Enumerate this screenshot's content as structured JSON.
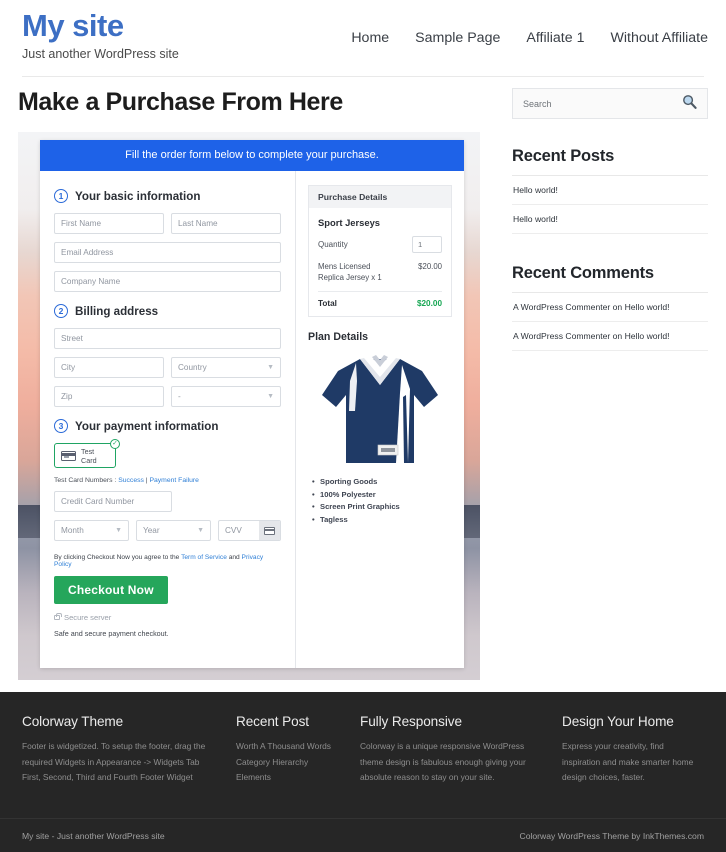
{
  "header": {
    "site_title": "My site",
    "tagline": "Just another WordPress site",
    "nav": [
      {
        "label": "Home"
      },
      {
        "label": "Sample Page"
      },
      {
        "label": "Affiliate 1"
      },
      {
        "label": "Without Affiliate"
      }
    ]
  },
  "main": {
    "page_title": "Make a Purchase From Here",
    "banner": "Fill the order form below to complete your purchase.",
    "steps": [
      {
        "num": "1",
        "title": "Your basic information"
      },
      {
        "num": "2",
        "title": "Billing address"
      },
      {
        "num": "3",
        "title": "Your payment information"
      }
    ],
    "fields": {
      "first_name": "First Name",
      "last_name": "Last Name",
      "email": "Email Address",
      "company": "Company Name",
      "street": "Street",
      "city": "City",
      "country": "Country",
      "zip": "Zip",
      "state": "-",
      "credit_card": "Credit Card Number",
      "month": "Month",
      "year": "Year",
      "cvv": "CVV"
    },
    "payment": {
      "chip_label": "Test Card",
      "check_glyph": "✓",
      "test_numbers_prefix": "Test Card Numbers : ",
      "success_link": "Success",
      "separator": " | ",
      "failure_link": "Payment Failure"
    },
    "terms": {
      "prefix": "By clicking Checkout Now you agree to the ",
      "tos": "Term of Service",
      "mid": " and ",
      "privacy": "Privacy Policy"
    },
    "checkout_button": "Checkout Now",
    "secure_server": "Secure server",
    "safe_note": "Safe and secure payment checkout."
  },
  "purchase_details": {
    "heading": "Purchase Details",
    "product": "Sport Jerseys",
    "quantity_label": "Quantity",
    "quantity_value": "1",
    "line_item_desc": "Mens Licensed Replica Jersey x 1",
    "line_item_price": "$20.00",
    "total_label": "Total",
    "total_value": "$20.00",
    "total_color": "#18a754"
  },
  "plan_details": {
    "title": "Plan Details",
    "features": [
      "Sporting Goods",
      "100% Polyester",
      "Screen Print Graphics",
      "Tagless"
    ]
  },
  "sidebar": {
    "search_placeholder": "Search",
    "recent_posts_title": "Recent Posts",
    "recent_posts": [
      "Hello world!",
      "Hello world!"
    ],
    "recent_comments_title": "Recent Comments",
    "recent_comments": [
      "A WordPress Commenter on Hello world!",
      "A WordPress Commenter on Hello world!"
    ]
  },
  "footer": {
    "columns": [
      {
        "title": "Colorway Theme",
        "text": "Footer is widgetized. To setup the footer, drag the required Widgets in Appearance -> Widgets Tab First, Second, Third and Fourth Footer Widget"
      },
      {
        "title": "Recent Post",
        "items": [
          "Worth A Thousand Words",
          "Category Hierarchy",
          "Elements"
        ]
      },
      {
        "title": "Fully Responsive",
        "text": "Colorway is a unique responsive WordPress theme design is fabulous enough giving your absolute reason to stay on your site."
      },
      {
        "title": "Design Your Home",
        "text": "Express your creativity, find inspiration and make smarter home design choices, faster."
      }
    ],
    "copyright_left": "My site - Just another WordPress site",
    "copyright_right": "Colorway WordPress Theme by InkThemes.com"
  },
  "theme": {
    "brand_blue": "#3d6fc4",
    "banner_blue": "#1e62e8",
    "checkout_green": "#25a65b",
    "link_blue": "#2f7fd6"
  }
}
